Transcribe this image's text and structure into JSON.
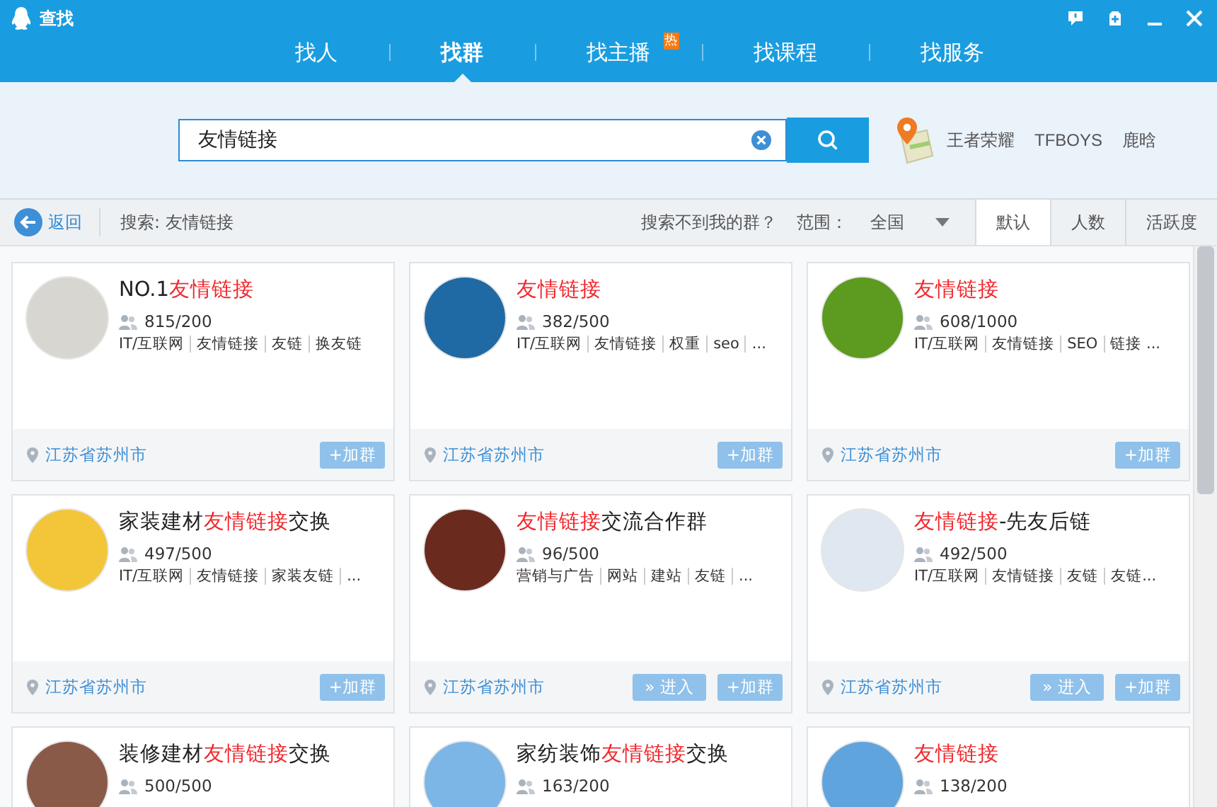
{
  "window": {
    "title": "查找"
  },
  "nav_tabs": [
    {
      "label": "找人",
      "selected": false
    },
    {
      "label": "找群",
      "selected": true
    },
    {
      "label": "找主播",
      "selected": false,
      "badge": "热"
    },
    {
      "label": "找课程",
      "selected": false
    },
    {
      "label": "找服务",
      "selected": false
    }
  ],
  "search": {
    "value": "友情链接"
  },
  "hot_keywords": [
    "王者荣耀",
    "TFBOYS",
    "鹿晗"
  ],
  "filter_bar": {
    "back": "返回",
    "query": "搜索: 友情链接",
    "help_link": "搜索不到我的群？",
    "scope_label": "范围：",
    "scope_value": "全国"
  },
  "sort_tabs": [
    {
      "label": "默认",
      "selected": true
    },
    {
      "label": "人数",
      "selected": false
    },
    {
      "label": "活跃度",
      "selected": false
    }
  ],
  "groups": [
    {
      "title": [
        {
          "text": "NO.1",
          "highlight": false
        },
        {
          "text": "友情链接",
          "highlight": true
        }
      ],
      "members": "815/200",
      "tags": [
        "IT/互联网",
        "友情链接",
        "友链",
        "换友链"
      ],
      "location": "江苏省苏州市",
      "buttons": [
        {
          "kind": "join",
          "label": "+加群"
        }
      ]
    },
    {
      "title": [
        {
          "text": "友情链接",
          "highlight": true
        }
      ],
      "members": "382/500",
      "tags": [
        "IT/互联网",
        "友情链接",
        "权重",
        "seo",
        "..."
      ],
      "location": "江苏省苏州市",
      "buttons": [
        {
          "kind": "join",
          "label": "+加群"
        }
      ]
    },
    {
      "title": [
        {
          "text": "友情链接",
          "highlight": true
        }
      ],
      "members": "608/1000",
      "tags": [
        "IT/互联网",
        "友情链接",
        "SEO",
        "链接 ..."
      ],
      "location": "江苏省苏州市",
      "buttons": [
        {
          "kind": "join",
          "label": "+加群"
        }
      ]
    },
    {
      "title": [
        {
          "text": "家装建材",
          "highlight": false
        },
        {
          "text": "友情链接",
          "highlight": true
        },
        {
          "text": "交换",
          "highlight": false
        }
      ],
      "members": "497/500",
      "tags": [
        "IT/互联网",
        "友情链接",
        "家装友链",
        "..."
      ],
      "location": "江苏省苏州市",
      "buttons": [
        {
          "kind": "join",
          "label": "+加群"
        }
      ]
    },
    {
      "title": [
        {
          "text": "友情链接",
          "highlight": true
        },
        {
          "text": "交流合作群",
          "highlight": false
        }
      ],
      "members": "96/500",
      "tags": [
        "营销与广告",
        "网站",
        "建站",
        "友链",
        "..."
      ],
      "location": "江苏省苏州市",
      "buttons": [
        {
          "kind": "enter",
          "label": "» 进入"
        },
        {
          "kind": "join",
          "label": "+加群"
        }
      ]
    },
    {
      "title": [
        {
          "text": "友情链接",
          "highlight": true
        },
        {
          "text": "-先友后链",
          "highlight": false
        }
      ],
      "members": "492/500",
      "tags": [
        "IT/互联网",
        "友情链接",
        "友链",
        "友链..."
      ],
      "location": "江苏省苏州市",
      "buttons": [
        {
          "kind": "enter",
          "label": "» 进入"
        },
        {
          "kind": "join",
          "label": "+加群"
        }
      ]
    },
    {
      "title": [
        {
          "text": "装修建材",
          "highlight": false
        },
        {
          "text": "友情链接",
          "highlight": true
        },
        {
          "text": "交换",
          "highlight": false
        }
      ],
      "members": "500/500"
    },
    {
      "title": [
        {
          "text": "家纺装饰",
          "highlight": false
        },
        {
          "text": "友情链接",
          "highlight": true
        },
        {
          "text": "交换",
          "highlight": false
        }
      ],
      "members": "163/200"
    },
    {
      "title": [
        {
          "text": "友情链接",
          "highlight": true
        }
      ],
      "members": "138/200"
    }
  ]
}
